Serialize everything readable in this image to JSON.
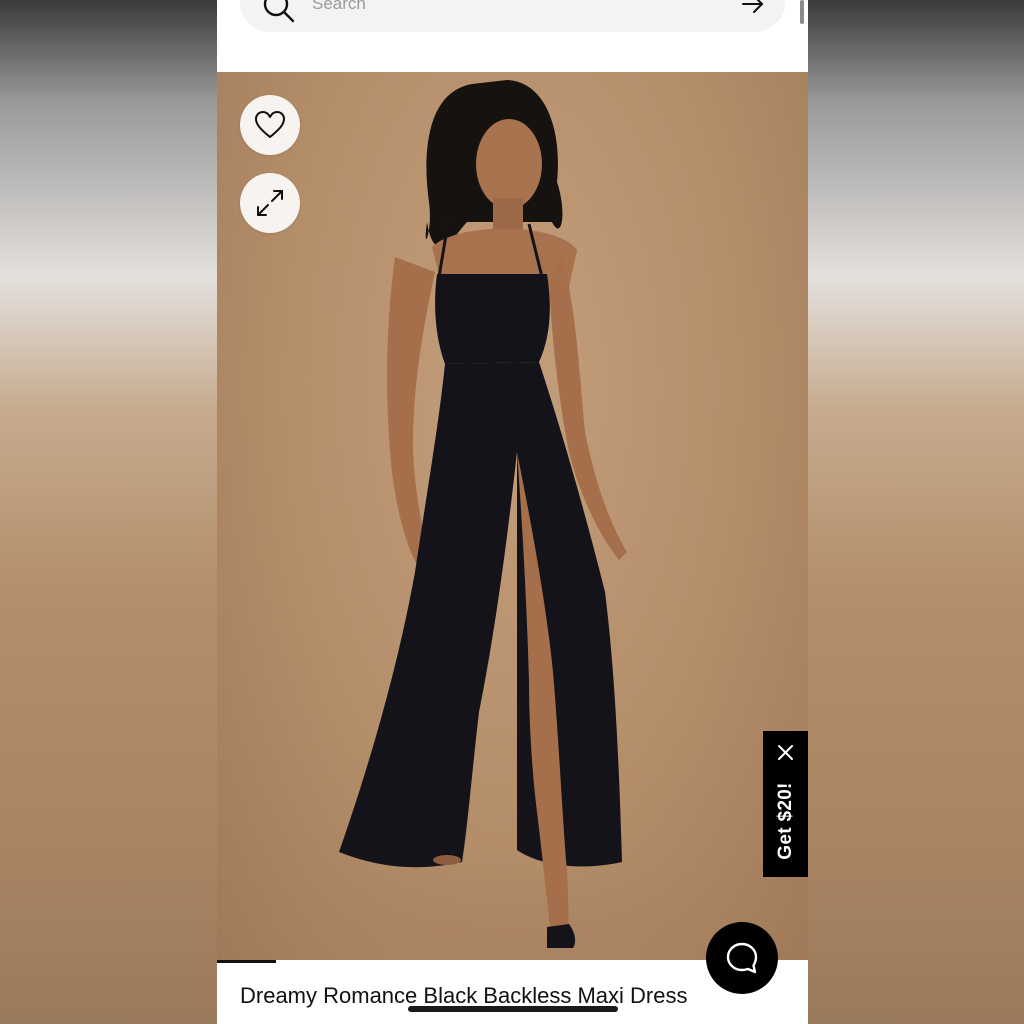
{
  "search": {
    "placeholder": "Search"
  },
  "product": {
    "title": "Dreamy Romance Black Backless Maxi Dress",
    "image_alt": "Model wearing black backless maxi dress with thigh-high slit"
  },
  "promo": {
    "label": "Get $20!"
  },
  "icons": {
    "search": "search-icon",
    "go": "arrow-right-icon",
    "wishlist": "heart-icon",
    "expand": "expand-icon",
    "close": "close-icon",
    "chat": "chat-bubble-icon"
  },
  "colors": {
    "backdrop": "#b48d69",
    "dress": "#141319",
    "promo_bg": "#000000",
    "chat_bg": "#000000"
  }
}
